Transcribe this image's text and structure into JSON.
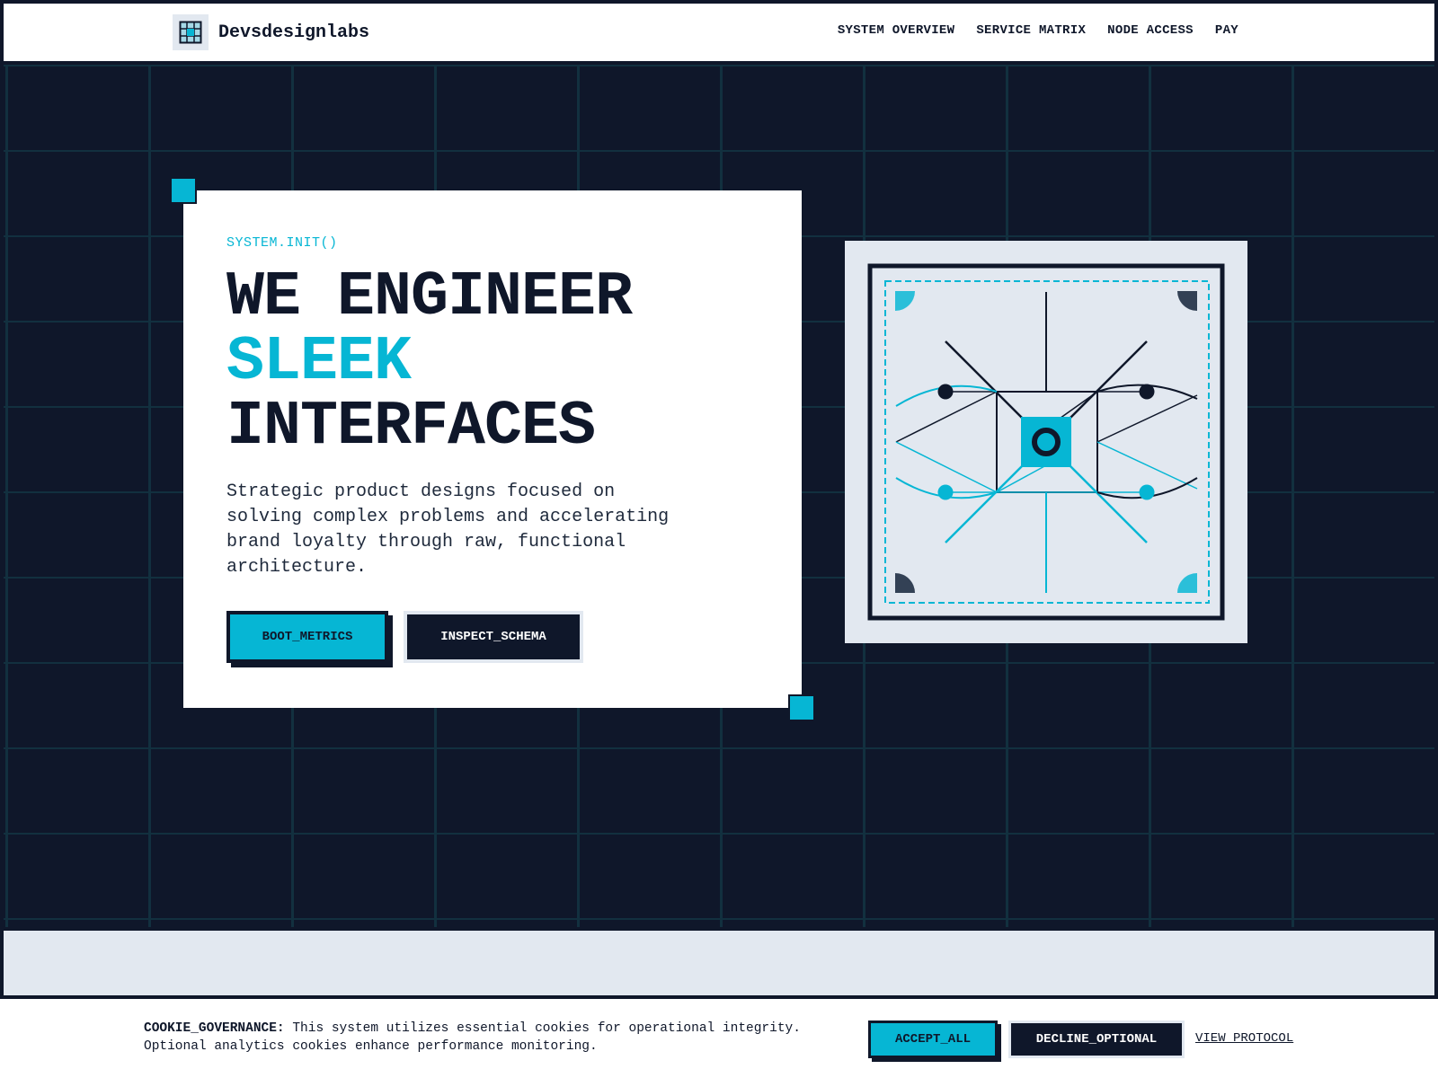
{
  "header": {
    "brand_name": "Devsdesignlabs",
    "logo_icon": "grid-logo-icon",
    "nav": [
      {
        "label": "SYSTEM OVERVIEW"
      },
      {
        "label": "SERVICE MATRIX"
      },
      {
        "label": "NODE ACCESS"
      },
      {
        "label": "PAY"
      }
    ]
  },
  "hero": {
    "eyebrow": "SYSTEM.INIT()",
    "headline_line1": "WE ENGINEER",
    "headline_accent": "SLEEK",
    "headline_line3": "INTERFACES",
    "lede": "Strategic product designs focused on solving complex problems and accelerating brand loyalty through raw, functional architecture.",
    "primary_button": "BOOT_METRICS",
    "secondary_button": "INSPECT_SCHEMA",
    "visual_icon": "circuit-schematic-illustration"
  },
  "cookie": {
    "label": "COOKIE_GOVERNANCE:",
    "text": "This system utilizes essential cookies for operational integrity. Optional analytics cookies enhance performance monitoring.",
    "accept": "ACCEPT_ALL",
    "decline": "DECLINE_OPTIONAL",
    "protocol_link": "VIEW PROTOCOL"
  },
  "colors": {
    "dark": "#0f172a",
    "accent": "#06b6d4",
    "light": "#e2e8f0",
    "white": "#ffffff"
  }
}
